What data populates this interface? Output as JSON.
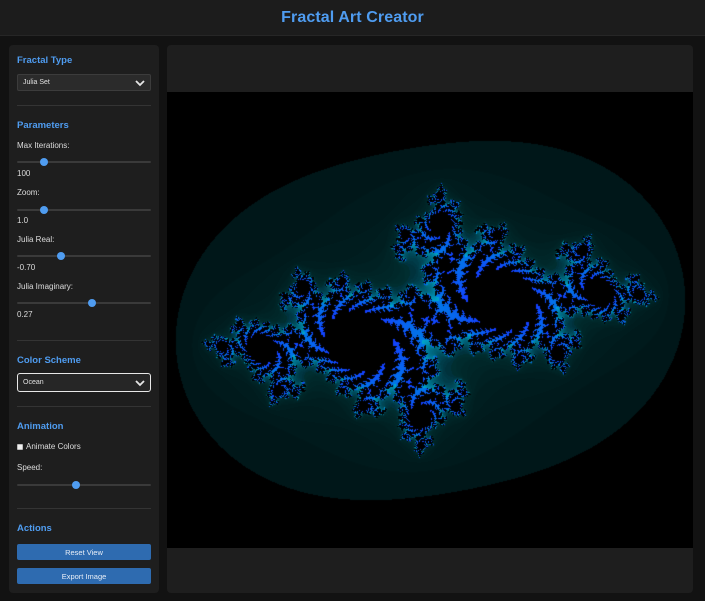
{
  "header": {
    "title": "Fractal Art Creator"
  },
  "sidebar": {
    "fractal_type": {
      "title": "Fractal Type",
      "selected": "Julia Set"
    },
    "parameters": {
      "title": "Parameters",
      "max_iterations": {
        "label": "Max Iterations:",
        "value": "100",
        "level": 0.2
      },
      "zoom": {
        "label": "Zoom:",
        "value": "1.0",
        "level": 0.2
      },
      "julia_real": {
        "label": "Julia Real:",
        "value": "-0.70",
        "level": 0.33
      },
      "julia_imaginary": {
        "label": "Julia Imaginary:",
        "value": "0.27",
        "level": 0.56
      }
    },
    "color_scheme": {
      "title": "Color Scheme",
      "selected": "Ocean"
    },
    "animation": {
      "title": "Animation",
      "animate_colors_label": "Animate Colors",
      "animate_colors_checked": false,
      "speed_label": "Speed:",
      "speed_level": 0.44
    },
    "actions": {
      "title": "Actions",
      "reset_label": "Reset View",
      "export_label": "Export Image"
    }
  },
  "colors": {
    "accent": "#4f9cf0",
    "button": "#2e6bb0",
    "panel": "#1e1e1e",
    "background": "#121212"
  },
  "icons": {
    "select_chevron": "chevron-down-icon"
  }
}
